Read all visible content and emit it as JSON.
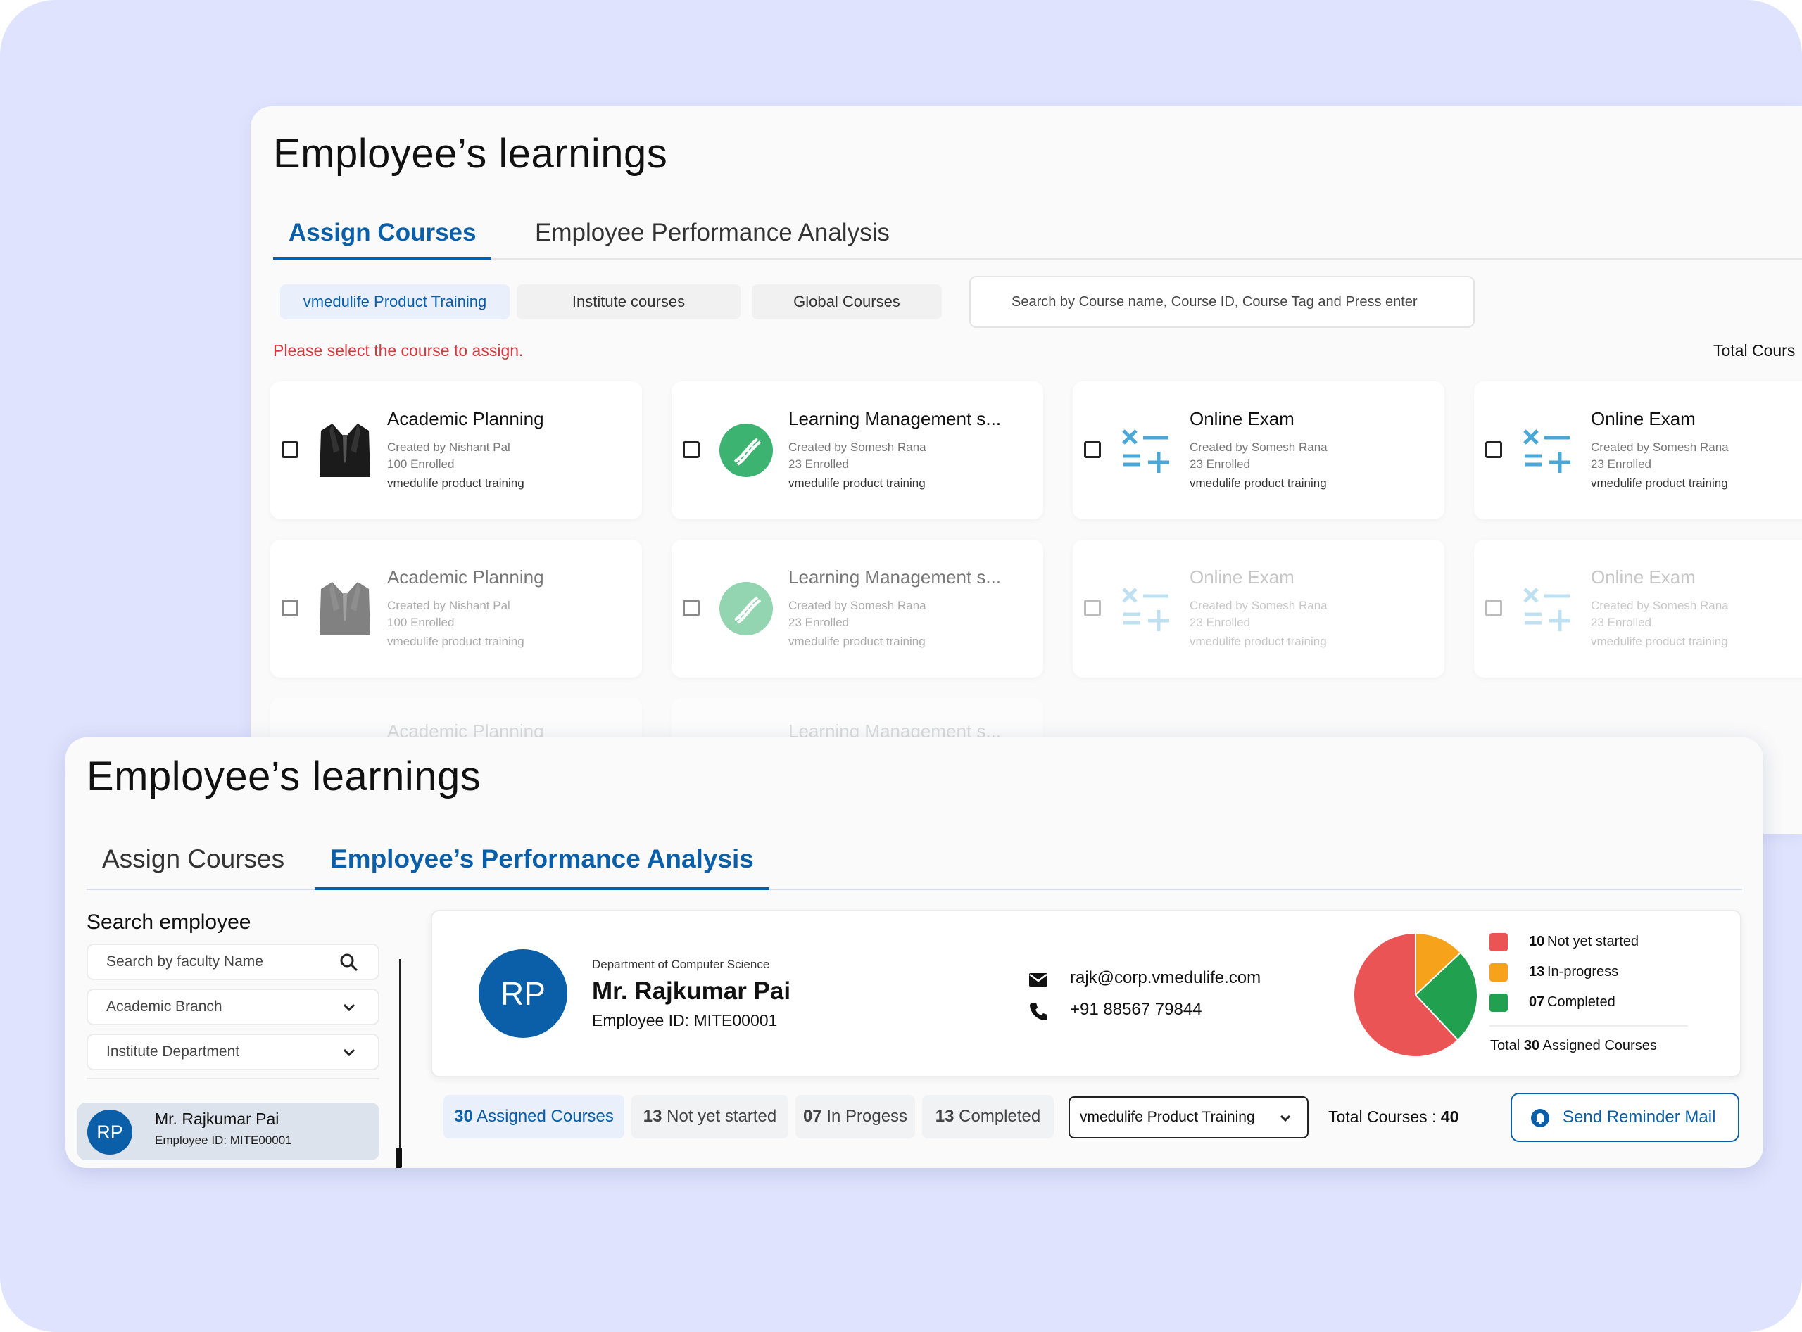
{
  "back_panel": {
    "title": "Employee’s learnings",
    "tabs": [
      {
        "label": "Assign Courses",
        "active": true
      },
      {
        "label": "Employee Performance Analysis",
        "active": false
      }
    ],
    "filter_chips": [
      {
        "label": "vmedulife Product Training",
        "active": true
      },
      {
        "label": "Institute courses",
        "active": false
      },
      {
        "label": "Global Courses",
        "active": false
      }
    ],
    "search_placeholder": "Search by Course name, Course ID, Course Tag and Press enter",
    "warning": "Please select the course to assign.",
    "total_label": "Total Cours",
    "courses": [
      {
        "name": "Academic Planning",
        "creator": "Created by Nishant Pal",
        "enrolled": "100 Enrolled",
        "category": "vmedulife product training",
        "icon": "suit-icon"
      },
      {
        "name": "Learning Management s...",
        "creator": "Created by Somesh Rana",
        "enrolled": "23 Enrolled",
        "category": "vmedulife product training",
        "icon": "dna-icon"
      },
      {
        "name": "Online Exam",
        "creator": "Created by Somesh Rana",
        "enrolled": "23 Enrolled",
        "category": "vmedulife product training",
        "icon": "math-symbols-icon"
      },
      {
        "name": "Online Exam",
        "creator": "Created by Somesh Rana",
        "enrolled": "23 Enrolled",
        "category": "vmedulife product training",
        "icon": "math-symbols-icon"
      },
      {
        "name": "Academic Planning",
        "creator": "Created by Nishant Pal",
        "enrolled": "100 Enrolled",
        "category": "vmedulife product training",
        "icon": "suit-icon"
      },
      {
        "name": "Learning Management s...",
        "creator": "Created by Somesh Rana",
        "enrolled": "23 Enrolled",
        "category": "vmedulife product training",
        "icon": "dna-icon"
      },
      {
        "name": "Online Exam",
        "creator": "Created by Somesh Rana",
        "enrolled": "23 Enrolled",
        "category": "vmedulife product training",
        "icon": "math-symbols-icon"
      },
      {
        "name": "Online Exam",
        "creator": "Created by Somesh Rana",
        "enrolled": "23 Enrolled",
        "category": "vmedulife product training",
        "icon": "math-symbols-icon"
      }
    ],
    "partial_row": [
      "Academic Planning",
      "Learning Management s..."
    ]
  },
  "front_panel": {
    "title": "Employee’s learnings",
    "tabs": [
      {
        "label": "Assign Courses",
        "active": false
      },
      {
        "label": "Employee’s Performance Analysis",
        "active": true
      }
    ],
    "sidebar": {
      "label": "Search employee",
      "search_placeholder": "Search by faculty Name",
      "branch_select": "Academic Branch",
      "department_select": "Institute Department",
      "employee": {
        "initials": "RP",
        "name": "Mr. Rajkumar Pai",
        "id": "Employee ID: MITE00001"
      }
    },
    "profile": {
      "initials": "RP",
      "department": "Department of Computer Science",
      "name": "Mr. Rajkumar Pai",
      "employee_id": "Employee ID: MITE00001",
      "email": "rajk@corp.vmedulife.com",
      "phone": "+91 88567 79844"
    },
    "legend": [
      {
        "count": "10",
        "label": "Not yet started",
        "color": "#ea5455"
      },
      {
        "count": "13",
        "label": "In-progress",
        "color": "#f7a21b"
      },
      {
        "count": "07",
        "label": "Completed",
        "color": "#21a04f"
      }
    ],
    "legend_total_prefix": "Total",
    "legend_total_value": "30",
    "legend_total_suffix": "Assigned Courses",
    "status_pills": [
      {
        "count": "30",
        "label": "Assigned Courses",
        "active": true
      },
      {
        "count": "13",
        "label": "Not yet started",
        "active": false
      },
      {
        "count": "07",
        "label": "In Progess",
        "active": false
      },
      {
        "count": "13",
        "label": "Completed",
        "active": false
      }
    ],
    "course_filter": "vmedulife Product Training",
    "total_courses_label": "Total Courses :",
    "total_courses_value": "40",
    "reminder_button": "Send Reminder Mail"
  },
  "chart_data": {
    "type": "pie",
    "categories": [
      "Not yet started",
      "In-progress",
      "Completed"
    ],
    "values": [
      10,
      13,
      7
    ],
    "slice_values_shown": [
      62,
      13,
      25
    ],
    "colors": [
      "#ea5455",
      "#f7a21b",
      "#21a04f"
    ]
  }
}
